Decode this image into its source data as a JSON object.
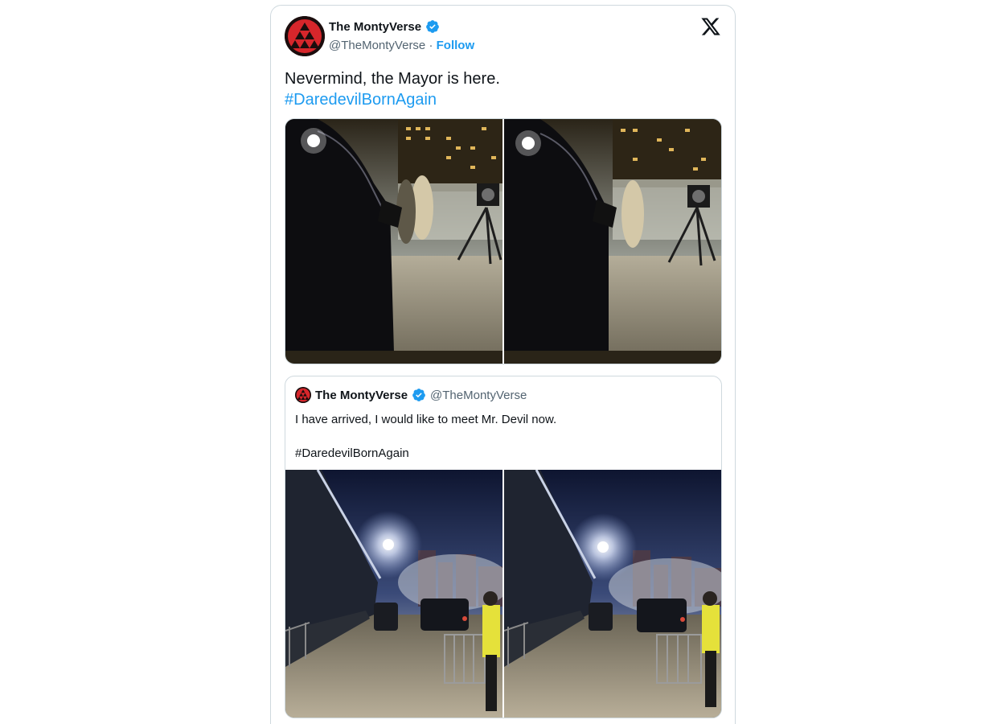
{
  "tweet": {
    "author_name": "The MontyVerse",
    "author_handle": "@TheMontyVerse",
    "separator": "·",
    "follow_label": "Follow",
    "text": "Nevermind, the Mayor is here.",
    "hashtag": "#DaredevilBornAgain",
    "photos": [
      "night-set-photo",
      "night-set-photo"
    ]
  },
  "quoted_tweet": {
    "author_name": "The MontyVerse",
    "author_handle": "@TheMontyVerse",
    "text": "I have arrived, I would like to meet Mr. Devil now.",
    "hashtag": "#DaredevilBornAgain",
    "photos": [
      "street-night-photo",
      "street-night-photo"
    ]
  },
  "icons": {
    "platform": "x-logo-icon",
    "verified": "verified-badge-icon"
  },
  "colors": {
    "accent": "#1d9bf0",
    "text": "#0f1419",
    "secondary": "#536471",
    "border": "#cfd9de",
    "avatar_red": "#d7262b"
  }
}
